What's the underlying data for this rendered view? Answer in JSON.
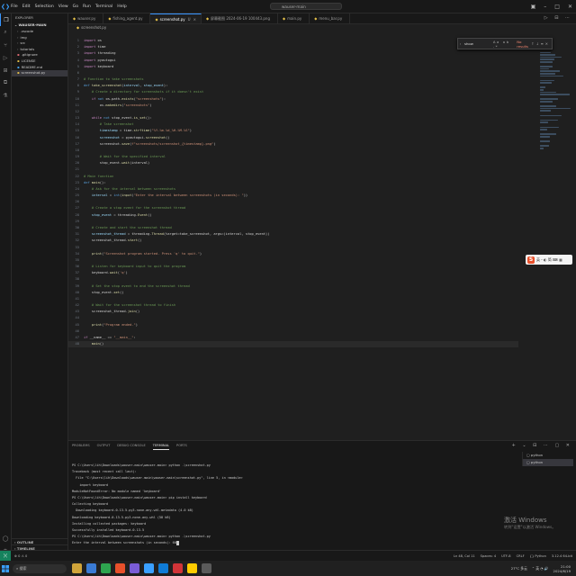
{
  "titlebar": {
    "menu": [
      "File",
      "Edit",
      "Selection",
      "View",
      "Go",
      "Run",
      "Terminal",
      "Help"
    ],
    "search": "wauser-main"
  },
  "explorer": {
    "header": "EXPLORER",
    "project": "WAUSER-MAIN",
    "items": [
      {
        "label": ".vscode",
        "type": "folder",
        "color": "#9d9d9d"
      },
      {
        "label": "img",
        "type": "folder",
        "color": "#9d9d9d"
      },
      {
        "label": "src",
        "type": "folder",
        "color": "#9d9d9d"
      },
      {
        "label": "tutorials",
        "type": "folder",
        "color": "#9d9d9d"
      },
      {
        "label": ".gitignore",
        "type": "file",
        "color": "#e06c75"
      },
      {
        "label": "LICENSE",
        "type": "file",
        "color": "#e8c34a"
      },
      {
        "label": "README.md",
        "type": "file",
        "color": "#42a5f5"
      },
      {
        "label": "screenshot.py",
        "type": "file",
        "color": "#e8c34a",
        "selected": true
      }
    ],
    "outline_label": "OUTLINE",
    "timeline_label": "TIMELINE"
  },
  "tabs": [
    {
      "label": "wauser.py",
      "active": false
    },
    {
      "label": "fishing_agent.py",
      "active": false
    },
    {
      "label": "screenshot.py",
      "active": true,
      "badge": "U"
    },
    {
      "label": "屏幕截图 2024-06-19 100443.png",
      "active": false
    },
    {
      "label": "main.py",
      "active": false
    },
    {
      "label": "menu_bar.py",
      "active": false
    }
  ],
  "breadcrumb": "screenshot.py",
  "find_widget": {
    "text": "show",
    "options": "Aa ab .*",
    "result": "No results"
  },
  "code_lines": [
    [
      {
        "t": "import",
        "c": "kw"
      },
      {
        "t": " os",
        "c": ""
      }
    ],
    [
      {
        "t": "import",
        "c": "kw"
      },
      {
        "t": " time",
        "c": ""
      }
    ],
    [
      {
        "t": "import",
        "c": "kw"
      },
      {
        "t": " threading",
        "c": ""
      }
    ],
    [
      {
        "t": "import",
        "c": "kw"
      },
      {
        "t": " pyautogui",
        "c": ""
      }
    ],
    [
      {
        "t": "import",
        "c": "kw"
      },
      {
        "t": " keyboard",
        "c": ""
      }
    ],
    [],
    [
      {
        "t": "# Function to take screenshots",
        "c": "com"
      }
    ],
    [
      {
        "t": "def",
        "c": "kd"
      },
      {
        "t": " ",
        "c": ""
      },
      {
        "t": "take_screenshot",
        "c": "fn"
      },
      {
        "t": "(",
        "c": ""
      },
      {
        "t": "interval",
        "c": "var"
      },
      {
        "t": ", ",
        "c": ""
      },
      {
        "t": "stop_event",
        "c": "var"
      },
      {
        "t": "):",
        "c": ""
      }
    ],
    [
      {
        "t": "    # Create a directory for screenshots if it doesn't exist",
        "c": "com"
      }
    ],
    [
      {
        "t": "    ",
        "c": ""
      },
      {
        "t": "if",
        "c": "kw"
      },
      {
        "t": " ",
        "c": ""
      },
      {
        "t": "not",
        "c": "kd"
      },
      {
        "t": " os.path.",
        "c": ""
      },
      {
        "t": "exists",
        "c": "fn"
      },
      {
        "t": "(",
        "c": ""
      },
      {
        "t": "\"screenshots\"",
        "c": "str"
      },
      {
        "t": "):",
        "c": ""
      }
    ],
    [
      {
        "t": "        os.",
        "c": ""
      },
      {
        "t": "makedirs",
        "c": "fn"
      },
      {
        "t": "(",
        "c": ""
      },
      {
        "t": "\"screenshots\"",
        "c": "str"
      },
      {
        "t": ")",
        "c": ""
      }
    ],
    [],
    [
      {
        "t": "    ",
        "c": ""
      },
      {
        "t": "while",
        "c": "kw"
      },
      {
        "t": " ",
        "c": ""
      },
      {
        "t": "not",
        "c": "kd"
      },
      {
        "t": " stop_event.",
        "c": ""
      },
      {
        "t": "is_set",
        "c": "fn"
      },
      {
        "t": "():",
        "c": ""
      }
    ],
    [
      {
        "t": "        # Take screenshot",
        "c": "com"
      }
    ],
    [
      {
        "t": "        timestamp",
        "c": "var"
      },
      {
        "t": " = time.",
        "c": ""
      },
      {
        "t": "strftime",
        "c": "fn"
      },
      {
        "t": "(",
        "c": ""
      },
      {
        "t": "\"%Y-%m-%d_%H-%M-%S\"",
        "c": "str"
      },
      {
        "t": ")",
        "c": ""
      }
    ],
    [
      {
        "t": "        screenshot",
        "c": "var"
      },
      {
        "t": " = pyautogui.",
        "c": ""
      },
      {
        "t": "screenshot",
        "c": "fn"
      },
      {
        "t": "()",
        "c": ""
      }
    ],
    [
      {
        "t": "        screenshot.",
        "c": ""
      },
      {
        "t": "save",
        "c": "fn"
      },
      {
        "t": "(",
        "c": ""
      },
      {
        "t": "f\"screenshots/screenshot_{timestamp}.png\"",
        "c": "str"
      },
      {
        "t": ")",
        "c": ""
      }
    ],
    [],
    [
      {
        "t": "        # Wait for the specified interval",
        "c": "com"
      }
    ],
    [
      {
        "t": "        stop_event.",
        "c": ""
      },
      {
        "t": "wait",
        "c": "fn"
      },
      {
        "t": "(interval)",
        "c": ""
      }
    ],
    [],
    [
      {
        "t": "# Main function",
        "c": "com"
      }
    ],
    [
      {
        "t": "def",
        "c": "kd"
      },
      {
        "t": " ",
        "c": ""
      },
      {
        "t": "main",
        "c": "fn"
      },
      {
        "t": "():",
        "c": ""
      }
    ],
    [
      {
        "t": "    # Ask for the interval between screenshots",
        "c": "com"
      }
    ],
    [
      {
        "t": "    interval",
        "c": "var"
      },
      {
        "t": " = ",
        "c": ""
      },
      {
        "t": "int",
        "c": "kd"
      },
      {
        "t": "(",
        "c": ""
      },
      {
        "t": "input",
        "c": "fn"
      },
      {
        "t": "(",
        "c": ""
      },
      {
        "t": "\"Enter the interval between screenshots (in seconds): \"",
        "c": "str"
      },
      {
        "t": "))",
        "c": ""
      }
    ],
    [],
    [
      {
        "t": "    # Create a stop event for the screenshot thread",
        "c": "com"
      }
    ],
    [
      {
        "t": "    stop_event",
        "c": "var"
      },
      {
        "t": " = threading.",
        "c": ""
      },
      {
        "t": "Event",
        "c": "fn"
      },
      {
        "t": "()",
        "c": ""
      }
    ],
    [],
    [
      {
        "t": "    # Create and start the screenshot thread",
        "c": "com"
      }
    ],
    [
      {
        "t": "    screenshot_thread",
        "c": "var"
      },
      {
        "t": " = threading.",
        "c": ""
      },
      {
        "t": "Thread",
        "c": "fn"
      },
      {
        "t": "(target=take_screenshot, args=(interval, stop_event))",
        "c": ""
      }
    ],
    [
      {
        "t": "    screenshot_thread.",
        "c": ""
      },
      {
        "t": "start",
        "c": "fn"
      },
      {
        "t": "()",
        "c": ""
      }
    ],
    [],
    [
      {
        "t": "    ",
        "c": ""
      },
      {
        "t": "print",
        "c": "fn"
      },
      {
        "t": "(",
        "c": ""
      },
      {
        "t": "\"Screenshot program started. Press 'q' to quit.\"",
        "c": "str"
      },
      {
        "t": ")",
        "c": ""
      }
    ],
    [],
    [
      {
        "t": "    # Listen for keyboard input to quit the program",
        "c": "com"
      }
    ],
    [
      {
        "t": "    keyboard.",
        "c": ""
      },
      {
        "t": "wait",
        "c": "fn"
      },
      {
        "t": "(",
        "c": ""
      },
      {
        "t": "'q'",
        "c": "str"
      },
      {
        "t": ")",
        "c": ""
      }
    ],
    [],
    [
      {
        "t": "    # Set the stop event to end the screenshot thread",
        "c": "com"
      }
    ],
    [
      {
        "t": "    stop_event.",
        "c": ""
      },
      {
        "t": "set",
        "c": "fn"
      },
      {
        "t": "()",
        "c": ""
      }
    ],
    [],
    [
      {
        "t": "    # Wait for the screenshot thread to finish",
        "c": "com"
      }
    ],
    [
      {
        "t": "    screenshot_thread.",
        "c": ""
      },
      {
        "t": "join",
        "c": "fn"
      },
      {
        "t": "()",
        "c": ""
      }
    ],
    [],
    [
      {
        "t": "    ",
        "c": ""
      },
      {
        "t": "print",
        "c": "fn"
      },
      {
        "t": "(",
        "c": ""
      },
      {
        "t": "\"Program ended.\"",
        "c": "str"
      },
      {
        "t": ")",
        "c": ""
      }
    ],
    [],
    [
      {
        "t": "if",
        "c": "kw"
      },
      {
        "t": " __name__ == ",
        "c": ""
      },
      {
        "t": "\"__main__\"",
        "c": "str"
      },
      {
        "t": ":",
        "c": ""
      }
    ],
    [
      {
        "t": "    ",
        "c": ""
      },
      {
        "t": "main",
        "c": "fn"
      },
      {
        "t": "()",
        "c": ""
      }
    ]
  ],
  "ime_toolbar": {
    "label": "英・◐ 简 ⌨ ▦"
  },
  "panel": {
    "tabs": [
      "PROBLEMS",
      "OUTPUT",
      "DEBUG CONSOLE",
      "TERMINAL",
      "PORTS"
    ],
    "active_tab": "TERMINAL",
    "terminal_lines": [
      "PS C:\\Users\\lih\\Downloads\\wauser-main\\wauser-main> python .\\screenshot.py",
      "Traceback (most recent call last):",
      "  File \"C:\\Users\\lih\\Downloads\\wauser-main\\wauser-main\\screenshot.py\", line 5, in <module>",
      "    import keyboard",
      "ModuleNotFoundError: No module named 'keyboard'",
      "PS C:\\Users\\lih\\Downloads\\wauser-main\\wauser-main> pip install keyboard",
      "Collecting keyboard",
      "  Downloading keyboard-0.13.5-py3-none-any.whl.metadata (4.0 kB)",
      "Downloading keyboard-0.13.5-py3-none-any.whl (58 kB)",
      "Installing collected packages: keyboard",
      "Successfully installed keyboard-0.13.5",
      "PS C:\\Users\\lih\\Downloads\\wauser-main\\wauser-main> python .\\screenshot.py",
      "Enter the interval between screenshots (in seconds): 60"
    ],
    "terminals": [
      "python",
      "python"
    ]
  },
  "watermark": {
    "title": "激活 Windows",
    "subtitle": "转到\"设置\"以激活 Windows。"
  },
  "statusbar": {
    "left": "⊗ 0 ⚠ 0",
    "right": [
      "Ln 48, Col 11",
      "Spaces: 4",
      "UTF-8",
      "CRLF",
      "{} Python",
      "3.12.4 64-bit"
    ]
  },
  "taskbar": {
    "search": "搜索",
    "weather": "27°C 多云",
    "time": "21:00",
    "date": "2024/6/19",
    "app_colors": [
      "#d0a43a",
      "#3a7bd5",
      "#2ea44f",
      "#e8502b",
      "#7a5cd6",
      "#3aa0ff",
      "#0f7bd6",
      "#d13438",
      "#ffcc00",
      "#5a5a5a"
    ]
  }
}
